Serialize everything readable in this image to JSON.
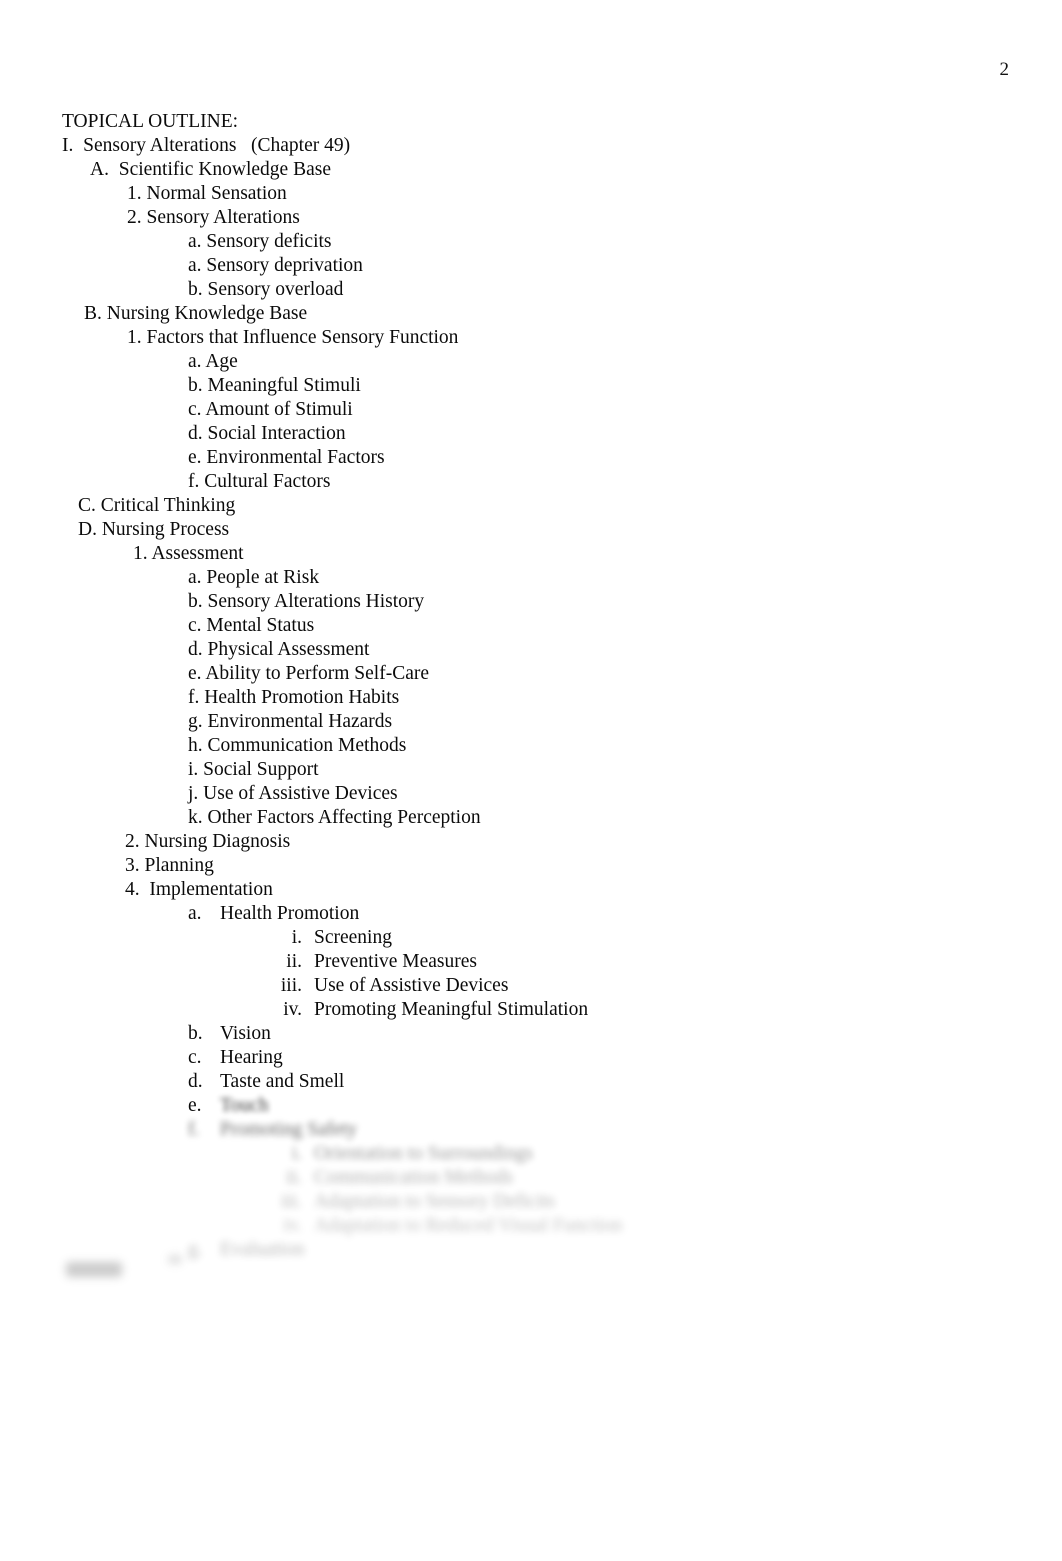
{
  "document": {
    "page_number": "2",
    "heading": "TOPICAL OUTLINE:"
  },
  "outline": {
    "section_i": {
      "marker": "I.",
      "title": "Sensory Alterations",
      "chapter": "(Chapter 49)"
    },
    "a_scientific": {
      "marker": "A.",
      "label": "Scientific Knowledge Base",
      "items": [
        {
          "marker": "1.",
          "label": "Normal Sensation"
        },
        {
          "marker": "2.",
          "label": "Sensory Alterations"
        }
      ],
      "subitems": [
        {
          "marker": "a.",
          "label": "Sensory deficits"
        },
        {
          "marker": "a.",
          "label": "Sensory deprivation"
        },
        {
          "marker": "b.",
          "label": "Sensory overload"
        }
      ]
    },
    "b_nursing": {
      "marker": "B.",
      "label": "Nursing Knowledge Base",
      "item1": {
        "marker": "1.",
        "label": "Factors that Influence Sensory Function"
      },
      "factors": [
        {
          "marker": "a.",
          "label": "Age"
        },
        {
          "marker": "b.",
          "label": "Meaningful Stimuli"
        },
        {
          "marker": "c.",
          "label": "Amount of Stimuli"
        },
        {
          "marker": "d.",
          "label": "Social Interaction"
        },
        {
          "marker": "e.",
          "label": "Environmental Factors"
        },
        {
          "marker": "f.",
          "label": "Cultural Factors"
        }
      ]
    },
    "c_critical": {
      "marker": "C.",
      "label": "Critical Thinking"
    },
    "d_process": {
      "marker": "D.",
      "label": "Nursing Process",
      "assessment": {
        "marker": "1.",
        "label": "Assessment"
      },
      "assessment_items": [
        {
          "marker": "a.",
          "label": "People at Risk"
        },
        {
          "marker": "b.",
          "label": "Sensory Alterations History"
        },
        {
          "marker": "c.",
          "label": "Mental Status"
        },
        {
          "marker": "d.",
          "label": "Physical Assessment"
        },
        {
          "marker": "e.",
          "label": "Ability to Perform Self-Care"
        },
        {
          "marker": "f.",
          "label": "Health Promotion Habits"
        },
        {
          "marker": "g.",
          "label": "Environmental Hazards"
        },
        {
          "marker": "h.",
          "label": "Communication Methods"
        },
        {
          "marker": "i.",
          "label": "Social Support"
        },
        {
          "marker": "j.",
          "label": "Use of Assistive Devices"
        },
        {
          "marker": "k.",
          "label": "Other Factors Affecting Perception"
        }
      ],
      "diagnosis": {
        "marker": "2.",
        "label": "Nursing Diagnosis"
      },
      "planning": {
        "marker": "3.",
        "label": "Planning"
      },
      "implementation": {
        "marker": "4.",
        "label": "Implementation"
      },
      "implementation_items": [
        {
          "marker": "a.",
          "label": "Health Promotion"
        },
        {
          "marker": "b.",
          "label": "Vision"
        },
        {
          "marker": "c.",
          "label": "Hearing"
        },
        {
          "marker": "d.",
          "label": "Taste and Smell"
        }
      ],
      "health_promotion_subitems": [
        {
          "marker": "i.",
          "label": "Screening"
        },
        {
          "marker": "ii.",
          "label": "Preventive Measures"
        },
        {
          "marker": "iii.",
          "label": "Use of Assistive Devices"
        },
        {
          "marker": "iv.",
          "label": "Promoting Meaningful Stimulation"
        }
      ],
      "obscured_items": [
        {
          "marker": "e.",
          "label": "Touch",
          "legible": false
        },
        {
          "marker": "f.",
          "label": "Promoting Safety",
          "legible": false
        }
      ],
      "obscured_subitems": [
        {
          "marker": "i.",
          "label": "Orientation to Surroundings",
          "legible": false
        },
        {
          "marker": "ii.",
          "label": "Communication Methods",
          "legible": false
        },
        {
          "marker": "iii.",
          "label": "Adaptation to Sensory Deficits",
          "legible": false
        },
        {
          "marker": "iv.",
          "label": "Adaptation to Reduced Visual Function",
          "legible": false
        }
      ],
      "obscured_last": {
        "marker": "g.",
        "label": "Evaluation",
        "legible": false
      }
    }
  }
}
